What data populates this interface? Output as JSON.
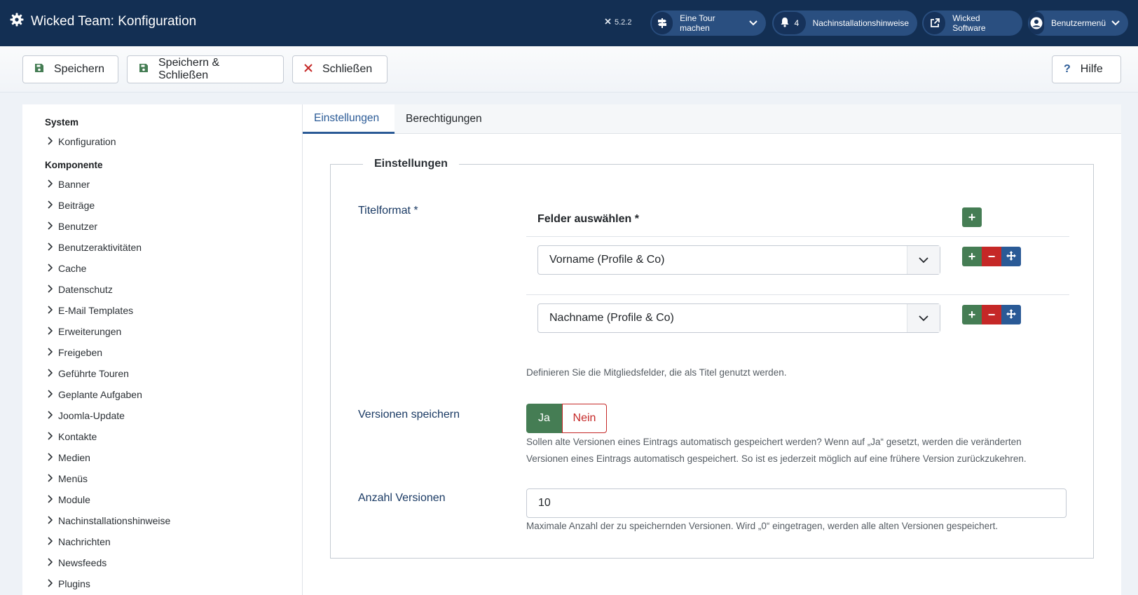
{
  "header": {
    "title": "Wicked Team: Konfiguration",
    "version": "5.2.2",
    "tour_label": "Eine Tour machen",
    "notifications_count": "4",
    "notifications_label": "Nachinstallationshinweise",
    "site_label": "Wicked Software",
    "user_menu_label": "Benutzermenü",
    "icons": [
      "gear-icon",
      "joomla-icon",
      "signpost-icon",
      "bell-icon",
      "external-link-icon",
      "user-icon",
      "chevron-down-icon"
    ]
  },
  "toolbar": {
    "save_label": "Speichern",
    "save_close_label": "Speichern & Schließen",
    "close_label": "Schließen",
    "help_label": "Hilfe"
  },
  "sidebar": {
    "sections": [
      {
        "heading": "System",
        "items": [
          "Konfiguration"
        ]
      },
      {
        "heading": "Komponente",
        "items": [
          "Banner",
          "Beiträge",
          "Benutzer",
          "Benutzeraktivitäten",
          "Cache",
          "Datenschutz",
          "E-Mail Templates",
          "Erweiterungen",
          "Freigeben",
          "Geführte Touren",
          "Geplante Aufgaben",
          "Joomla-Update",
          "Kontakte",
          "Medien",
          "Menüs",
          "Module",
          "Nachinstallationshinweise",
          "Nachrichten",
          "Newsfeeds",
          "Plugins"
        ]
      }
    ]
  },
  "tabs": [
    {
      "label": "Einstellungen",
      "active": true
    },
    {
      "label": "Berechtigungen",
      "active": false
    }
  ],
  "settings": {
    "legend": "Einstellungen",
    "titelformat_label": "Titelformat *",
    "fields_header": "Felder auswählen *",
    "field_rows": [
      {
        "value": "Vorname (Profile & Co)"
      },
      {
        "value": "Nachname (Profile & Co)"
      }
    ],
    "titelformat_hint": "Definieren Sie die Mitgliedsfelder, die als Titel genutzt werden.",
    "versions_label": "Versionen speichern",
    "versions_yes": "Ja",
    "versions_no": "Nein",
    "versions_selected": "Ja",
    "versions_hint_line1": "Sollen alte Versionen eines Eintrags automatisch gespeichert werden? Wenn auf „Ja“ gesetzt, werden die veränderten",
    "versions_hint_line2": "Versionen eines Eintrags automatisch gespeichert. So ist es jederzeit möglich auf eine frühere Version zurückzukehren.",
    "count_label": "Anzahl Versionen",
    "count_value": "10",
    "count_hint": "Maximale Anzahl der zu speichernden Versionen. Wird „0“ eingetragen, werden alle alten Versionen gespeichert."
  },
  "colors": {
    "header_bg": "#132f53",
    "primary_blue": "#2a5a96",
    "success_green": "#457d54",
    "danger_red": "#c52827"
  }
}
